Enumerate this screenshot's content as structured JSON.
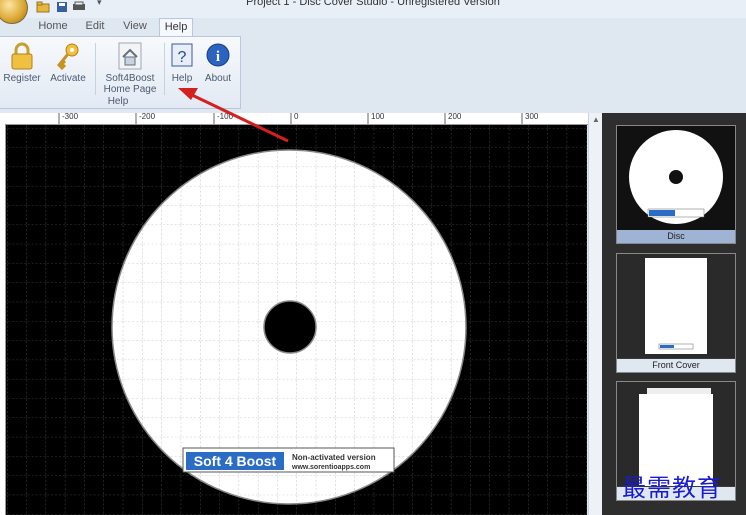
{
  "window": {
    "title": "Project 1 - Disc Cover Studio - Unregistered Version"
  },
  "tabs": [
    {
      "label": "Home"
    },
    {
      "label": "Edit"
    },
    {
      "label": "View"
    },
    {
      "label": "Help"
    }
  ],
  "ribbon": {
    "buttons": {
      "register": "Register",
      "activate": "Activate",
      "home_page_line1": "Soft4Boost",
      "home_page_line2": "Home Page",
      "help": "Help",
      "about": "About"
    },
    "group_label": "Help"
  },
  "ruler": {
    "top_ticks": [
      "-300",
      "-200",
      "-100",
      "0",
      "100",
      "200",
      "300"
    ]
  },
  "disc_label": {
    "brand": "Soft 4 Boost",
    "line1": "Non-activated version",
    "line2": "www.sorentioapps.com"
  },
  "thumbnails": [
    {
      "label": "Disc",
      "selected": true
    },
    {
      "label": "Front Cover",
      "selected": false
    },
    {
      "label": "",
      "selected": false
    }
  ],
  "watermark": "最需教育",
  "colors": {
    "annotation_arrow": "#d42020",
    "canvas_bg": "#000000",
    "selected_thumb": "#9fb4d4"
  }
}
